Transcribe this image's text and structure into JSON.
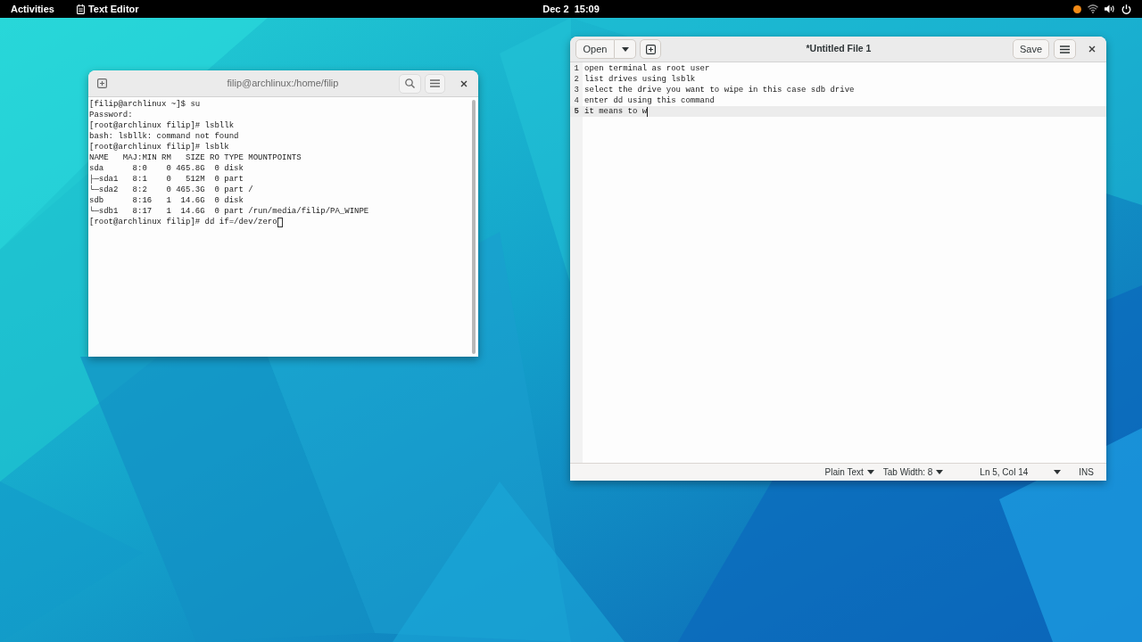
{
  "top_bar": {
    "activities": "Activities",
    "app_menu": "Text Editor",
    "clock": "Dec 2  15:09"
  },
  "terminal": {
    "title": "filip@archlinux:/home/filip",
    "lines": [
      {
        "text": "[filip@archlinux ~]$ su",
        "cursor": false
      },
      {
        "text": "Password:",
        "cursor": false
      },
      {
        "text": "[root@archlinux filip]# lsbllk",
        "cursor": false
      },
      {
        "text": "bash: lsbllk: command not found",
        "cursor": false
      },
      {
        "text": "[root@archlinux filip]# lsblk",
        "cursor": false
      },
      {
        "text": "NAME   MAJ:MIN RM   SIZE RO TYPE MOUNTPOINTS",
        "cursor": false
      },
      {
        "text": "sda      8:0    0 465.8G  0 disk",
        "cursor": false
      },
      {
        "text": "├─sda1   8:1    0   512M  0 part",
        "cursor": false
      },
      {
        "text": "└─sda2   8:2    0 465.3G  0 part /",
        "cursor": false
      },
      {
        "text": "sdb      8:16   1  14.6G  0 disk",
        "cursor": false
      },
      {
        "text": "└─sdb1   8:17   1  14.6G  0 part /run/media/filip/PA_WINPE",
        "cursor": false
      },
      {
        "text": "[root@archlinux filip]# dd if=/dev/zero",
        "cursor": true
      }
    ]
  },
  "editor": {
    "title": "*Untitled File 1",
    "open_button": "Open",
    "save_button": "Save",
    "lines": [
      {
        "number": "1",
        "text": "open terminal as root user",
        "current": false
      },
      {
        "number": "2",
        "text": "list drives using lsblk",
        "current": false
      },
      {
        "number": "3",
        "text": "select the drive you want to wipe in this case sdb drive",
        "current": false
      },
      {
        "number": "4",
        "text": "enter dd using this command",
        "current": false
      },
      {
        "number": "5",
        "text": "it means to w",
        "current": true
      }
    ],
    "status_bar": {
      "language": "Plain Text",
      "tab_width": "Tab Width: 8",
      "position": "Ln 5, Col 14",
      "mode": "INS"
    }
  }
}
